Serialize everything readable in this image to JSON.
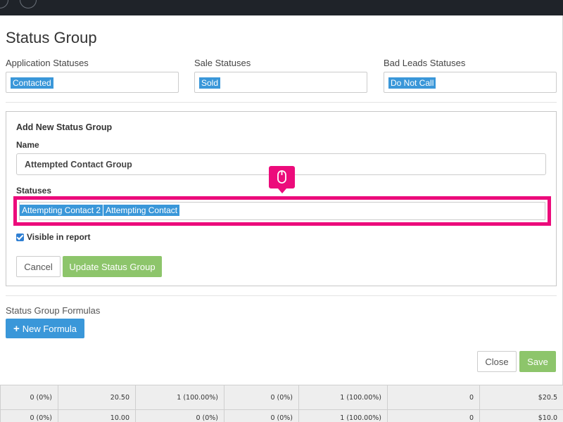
{
  "modal": {
    "title": "Status Group",
    "application_statuses": {
      "label": "Application Statuses",
      "tags": [
        "Contacted"
      ]
    },
    "sale_statuses": {
      "label": "Sale Statuses",
      "tags": [
        "Sold"
      ]
    },
    "bad_leads_statuses": {
      "label": "Bad Leads Statuses",
      "tags": [
        "Do Not Call"
      ]
    },
    "form": {
      "title": "Add New Status Group",
      "name_label": "Name",
      "name_value": "Attempted Contact Group",
      "statuses_label": "Statuses",
      "statuses_tags": [
        "Attempting Contact 2",
        "Attempting Contact"
      ],
      "visible_label": "Visible in report",
      "visible_checked": true,
      "cancel_label": "Cancel",
      "update_label": "Update Status Group"
    },
    "formulas_label": "Status Group Formulas",
    "new_formula_label": "New Formula",
    "close_label": "Close",
    "save_label": "Save",
    "icons": {
      "click_indicator": "mouse-icon",
      "new_formula": "plus-icon"
    },
    "colors": {
      "tag_blue": "#3a97d9",
      "primary_green": "#8dc56b",
      "highlight_pink": "#ec0b7b",
      "header_dark": "#1f2329"
    }
  },
  "background_table": {
    "rows": [
      [
        "0 (0%)",
        "20.50",
        "1 (100.00%)",
        "0 (0%)",
        "1 (100.00%)",
        "0",
        "$20.5"
      ],
      [
        "0 (0%)",
        "10.00",
        "0 (0%)",
        "0 (0%)",
        "1 (100.00%)",
        "0",
        "$10.0"
      ]
    ]
  }
}
